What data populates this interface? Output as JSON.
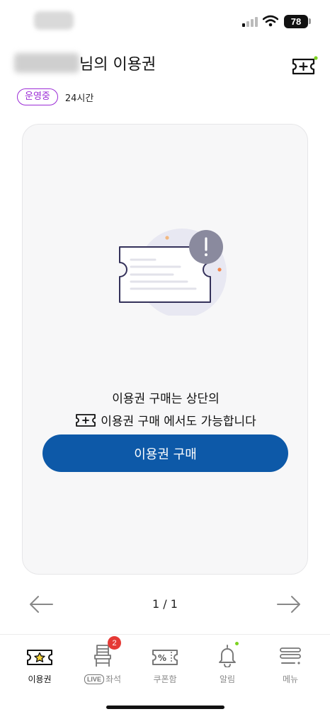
{
  "status_bar": {
    "battery": "78"
  },
  "header": {
    "title": "님의 이용권"
  },
  "status": {
    "badge": "운영중",
    "duration": "24시간"
  },
  "empty_state": {
    "line1": "이용권 구매는 상단의",
    "line2": "이용권 구매 에서도 가능합니다",
    "button": "이용권 구매"
  },
  "pager": {
    "indicator": "1 / 1"
  },
  "bottom_nav": {
    "items": [
      {
        "label": "이용권",
        "icon": "ticket-star-icon",
        "active": true
      },
      {
        "label": "좌석",
        "tag": "LIVE",
        "icon": "chair-icon",
        "badge": "2"
      },
      {
        "label": "쿠폰함",
        "icon": "coupon-icon"
      },
      {
        "label": "알림",
        "icon": "bell-icon"
      },
      {
        "label": "메뉴",
        "icon": "menu-icon"
      }
    ]
  },
  "colors": {
    "primary": "#0d59a8",
    "badge_purple": "#9b2bd6",
    "accent_green": "#7dd321",
    "alert_red": "#e53935"
  }
}
